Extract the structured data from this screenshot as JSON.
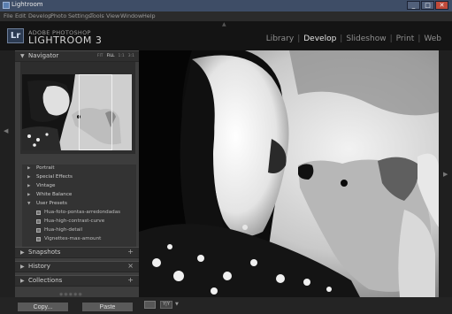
{
  "window": {
    "title": "Lightroom",
    "controls": {
      "minimize": "_",
      "maximize": "□",
      "close": "✕"
    }
  },
  "menu": [
    "File",
    "Edit",
    "Develop",
    "Photo",
    "Settings",
    "Tools",
    "View",
    "Window",
    "Help"
  ],
  "identity": {
    "logo": "Lr",
    "line1": "ADOBE PHOTOSHOP",
    "line2": "LIGHTROOM 3"
  },
  "modules": {
    "items": [
      "Library",
      "Develop",
      "Slideshow",
      "Print",
      "Web"
    ],
    "active": "Develop",
    "separator": "|"
  },
  "navigator": {
    "title": "Navigator",
    "zoom_options": [
      "FIT",
      "FILL",
      "1:1",
      "3:1"
    ],
    "zoom_selected": "FILL"
  },
  "presets": {
    "folders": [
      "Portrait",
      "Special Effects",
      "Vintage",
      "White Balance",
      "User Presets"
    ],
    "user_presets": [
      "Hua-foto-pontas-arredondadas",
      "Hua-high-contrast-curve",
      "Hua-high-detail",
      "Vignettes-max-amount"
    ]
  },
  "panels": {
    "snapshots": {
      "label": "Snapshots",
      "action": "+"
    },
    "history": {
      "label": "History",
      "action": "×"
    },
    "collections": {
      "label": "Collections",
      "action": "+"
    }
  },
  "buttons": {
    "copy": "Copy...",
    "paste": "Paste"
  },
  "toolbar": {
    "view_yy": "Y|Y"
  },
  "icons": {
    "app": "lightroom-app-icon",
    "panel_collapsed": "triangle-right-icon",
    "panel_expanded": "triangle-down-icon",
    "panel_side_left": "triangle-left-icon",
    "panel_side_right": "triangle-right-icon"
  },
  "colors": {
    "titlebar": "#3e4d66",
    "panel": "#3d3d3d",
    "background": "#1b1b1b",
    "active_module": "#e6e6e6"
  }
}
